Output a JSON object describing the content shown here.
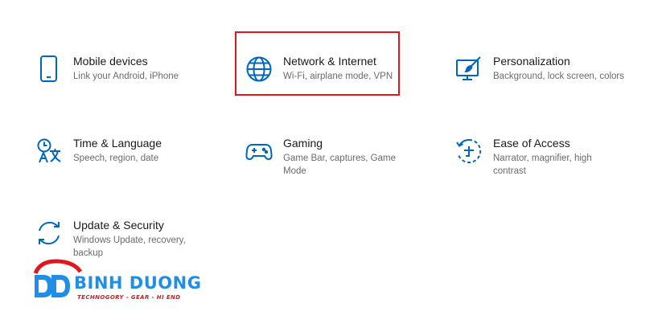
{
  "accent_color": "#0067c0",
  "highlight_color": "#e2161e",
  "tiles": [
    {
      "title": "Mobile devices",
      "desc": "Link your Android, iPhone",
      "icon": "phone-icon"
    },
    {
      "title": "Network & Internet",
      "desc": "Wi-Fi, airplane mode, VPN",
      "icon": "globe-icon"
    },
    {
      "title": "Personalization",
      "desc": "Background, lock screen, colors",
      "icon": "paint-brush-icon"
    },
    {
      "title": "Time & Language",
      "desc": "Speech, region, date",
      "icon": "time-language-icon"
    },
    {
      "title": "Gaming",
      "desc": "Game Bar, captures, Game Mode",
      "icon": "gamepad-icon"
    },
    {
      "title": "Ease of Access",
      "desc": "Narrator, magnifier, high contrast",
      "icon": "ease-of-access-icon"
    },
    {
      "title": "Update & Security",
      "desc": "Windows Update, recovery, backup",
      "icon": "sync-icon"
    }
  ],
  "watermark": {
    "brand": "BINH DUONG",
    "tagline": "TECHNOGORY - GEAR - HI END"
  }
}
